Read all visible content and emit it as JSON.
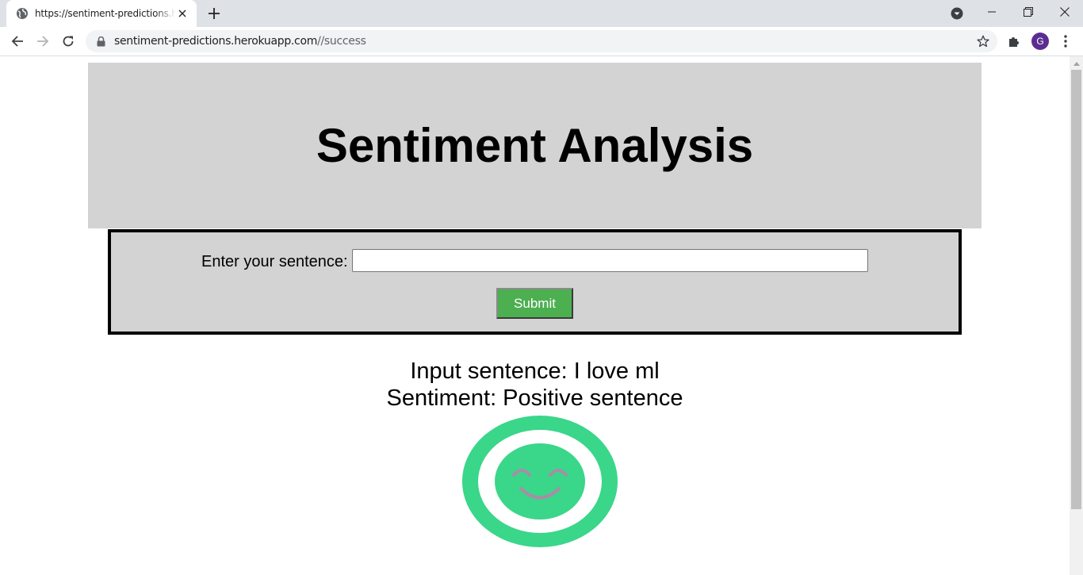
{
  "browser": {
    "tab_title": "https://sentiment-predictions.herokuapp.com//success",
    "url_host": "sentiment-predictions.herokuapp.com",
    "url_path": "//success",
    "avatar_letter": "G"
  },
  "page": {
    "title": "Sentiment Analysis",
    "form": {
      "label": "Enter your sentence:",
      "input_value": "",
      "submit_label": "Submit"
    },
    "result": {
      "input_line": "Input sentence: I love ml",
      "sentiment_line": "Sentiment: Positive sentence"
    },
    "icon": "smiley-face-icon"
  },
  "colors": {
    "header_bg": "#d3d3d3",
    "submit_bg": "#4caf50",
    "smiley_green": "#3ad68a",
    "smiley_features": "#a98da6"
  }
}
